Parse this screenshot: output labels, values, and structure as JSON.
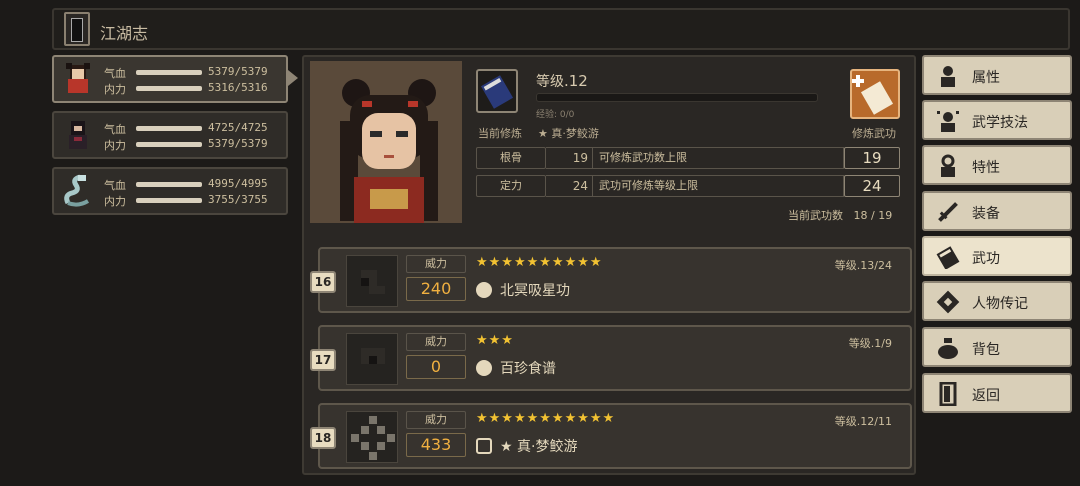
{
  "header": {
    "title": "江湖志"
  },
  "team": [
    {
      "hp_label": "气血",
      "hp": "5379/5379",
      "mp_label": "内力",
      "mp": "5316/5316",
      "active": true
    },
    {
      "hp_label": "气血",
      "hp": "4725/4725",
      "mp_label": "内力",
      "mp": "5379/5379",
      "active": false
    },
    {
      "hp_label": "气血",
      "hp": "4995/4995",
      "mp_label": "内力",
      "mp": "3755/3755",
      "active": false
    }
  ],
  "character": {
    "level_label": "等级",
    "level_value": ".12",
    "exp_text": "经验: 0/0",
    "exp_fraction": 0,
    "current_training_label": "当前修炼",
    "current_training_value": "★ 真·梦鲛游",
    "train_button_label": "修炼武功",
    "attributes": [
      {
        "name": "根骨",
        "value": "19",
        "desc": "可修炼武功数上限",
        "big": "19"
      },
      {
        "name": "定力",
        "value": "24",
        "desc": "武功可修炼等级上限",
        "big": "24"
      }
    ],
    "skill_count_label": "当前武功数",
    "skill_count_value": "18 / 19"
  },
  "skills": [
    {
      "index": "16",
      "power_label": "威力",
      "power": "240",
      "stars": "★★★★★★★★★★",
      "level": "等级.13/24",
      "name": "北冥吸星功",
      "icon": "yin-yang-icon"
    },
    {
      "index": "17",
      "power_label": "威力",
      "power": "0",
      "stars": "★★★",
      "level": "等级.1/9",
      "name": "百珍食谱",
      "icon": "yin-yang-icon"
    },
    {
      "index": "18",
      "power_label": "威力",
      "power": "433",
      "stars": "★★★★★★★★★★★",
      "level": "等级.12/11",
      "name": "★ 真·梦鲛游",
      "icon": "lock-icon"
    }
  ],
  "menu": [
    {
      "label": "属性",
      "icon": "person-icon",
      "active": false
    },
    {
      "label": "武学技法",
      "icon": "star-person-icon",
      "active": false
    },
    {
      "label": "特性",
      "icon": "person-outline-icon",
      "active": false
    },
    {
      "label": "装备",
      "icon": "sword-icon",
      "active": false
    },
    {
      "label": "武功",
      "icon": "book-icon",
      "active": true
    },
    {
      "label": "人物传记",
      "icon": "scroll-icon",
      "active": false
    },
    {
      "label": "背包",
      "icon": "bag-icon",
      "active": false
    },
    {
      "label": "返回",
      "icon": "door-icon",
      "active": false
    }
  ],
  "colors": {
    "accent_gold": "#f0b040",
    "star": "#f2c232",
    "panel": "#2a2724",
    "menu_bg": "#d9cfb8"
  }
}
